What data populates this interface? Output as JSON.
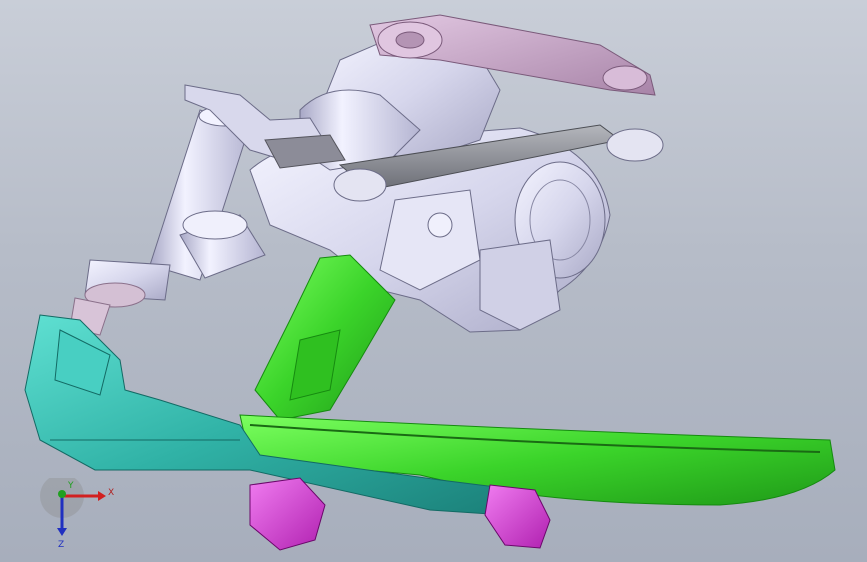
{
  "viewport": {
    "background_top": "#c9ced8",
    "background_bottom": "#a7aebc"
  },
  "parts": {
    "steel_color": "#d9d9ef",
    "pink_linkage_color": "#c9a9c9",
    "gray_linkage_color": "#8e9096",
    "green_part_color": "#3ddc2a",
    "teal_part_color": "#35b8ac",
    "magenta_part_color": "#d63ed6"
  },
  "triad": {
    "x_label": "X",
    "y_label": "Y",
    "z_label": "Z",
    "x_color": "#d22020",
    "y_color": "#20a020",
    "z_color": "#2030c0"
  }
}
